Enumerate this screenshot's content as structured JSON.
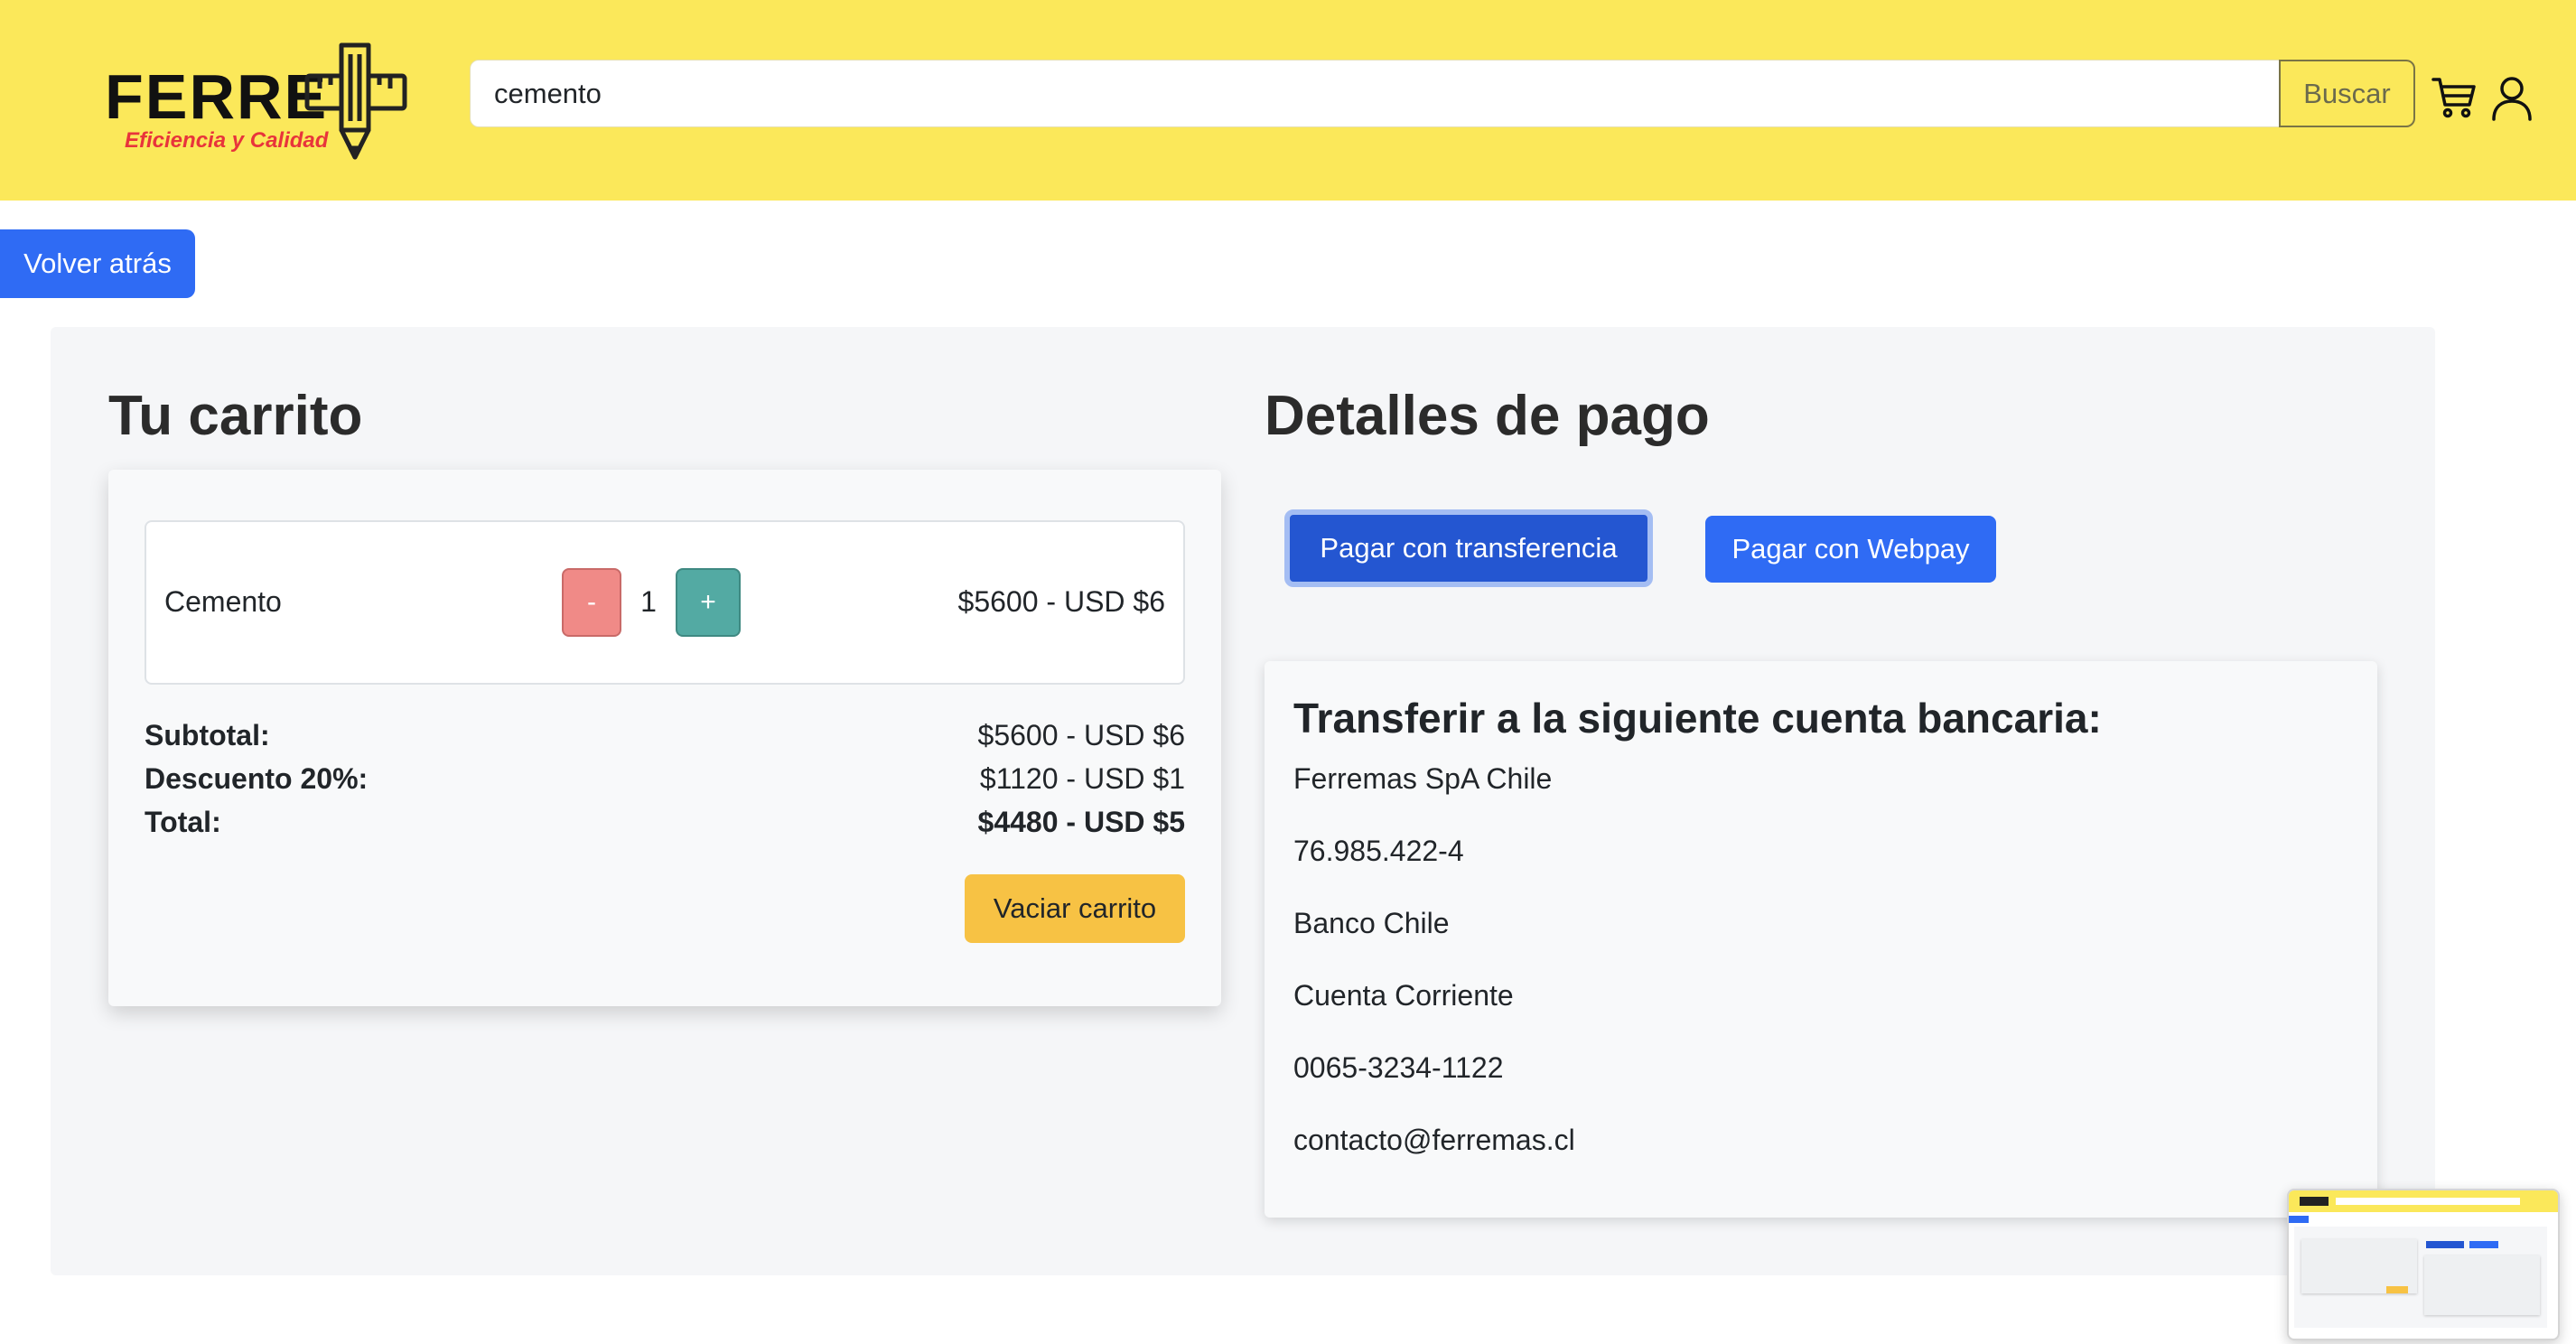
{
  "header": {
    "logo_text": "FERRE",
    "logo_tagline": "Eficiencia y Calidad",
    "search": {
      "value": "cemento",
      "placeholder": ""
    },
    "search_button_label": "Buscar",
    "icons": {
      "cart": "cart-icon",
      "user": "user-icon"
    },
    "background_color": "#fbe85a"
  },
  "back_button_label": "Volver atrás",
  "cart": {
    "title": "Tu carrito",
    "items": [
      {
        "name": "Cemento",
        "decrement_label": "-",
        "quantity": "1",
        "increment_label": "+",
        "price": "$5600 - USD $6"
      }
    ],
    "summary": {
      "subtotal_label": "Subtotal:",
      "subtotal_value": "$5600 - USD $6",
      "discount_label": "Descuento 20%:",
      "discount_value": "$1120 - USD $1",
      "total_label": "Total:",
      "total_value": "$4480 - USD $5"
    },
    "empty_button_label": "Vaciar carrito"
  },
  "payment": {
    "title": "Detalles de pago",
    "transfer_button_label": "Pagar con transferencia",
    "webpay_button_label": "Pagar con Webpay",
    "bank": {
      "title": "Transferir a la siguiente cuenta bancaria:",
      "lines": [
        "Ferremas SpA Chile",
        "76.985.422-4",
        "Banco Chile",
        "Cuenta Corriente",
        "0065-3234-1122",
        "contacto@ferremas.cl"
      ]
    }
  },
  "colors": {
    "primary": "#2f6bf4",
    "primary_active": "#2456d1",
    "warning": "#f7c244",
    "danger_soft": "#f08a87",
    "teal": "#53aaa3"
  }
}
